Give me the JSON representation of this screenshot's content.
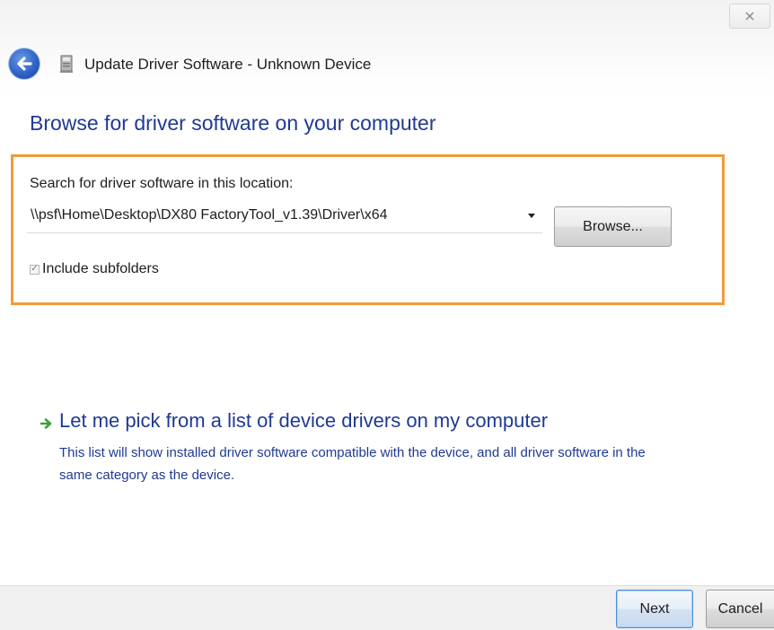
{
  "window": {
    "title": "Update Driver Software - Unknown Device",
    "close_icon": "close-icon",
    "back_icon": "back-arrow-icon",
    "device_icon": "device-icon"
  },
  "main": {
    "heading": "Browse for driver software on your computer",
    "search": {
      "label": "Search for driver software in this location:",
      "path_value": "\\\\psf\\Home\\Desktop\\DX80 FactoryTool_v1.39\\Driver\\x64",
      "browse_label": "Browse...",
      "include_subfolders_label": "Include subfolders",
      "include_subfolders_checked": true
    },
    "pick": {
      "link_text": "Let me pick from a list of device drivers on my computer",
      "description": "This list will show installed driver software compatible with the device, and all driver software in the same category as the device.",
      "arrow_icon": "green-arrow-icon"
    }
  },
  "footer": {
    "next_label": "Next",
    "cancel_label": "Cancel"
  },
  "colors": {
    "heading_blue": "#1f3a93",
    "highlight_orange": "#f29a38",
    "arrow_green": "#3aa23a"
  }
}
